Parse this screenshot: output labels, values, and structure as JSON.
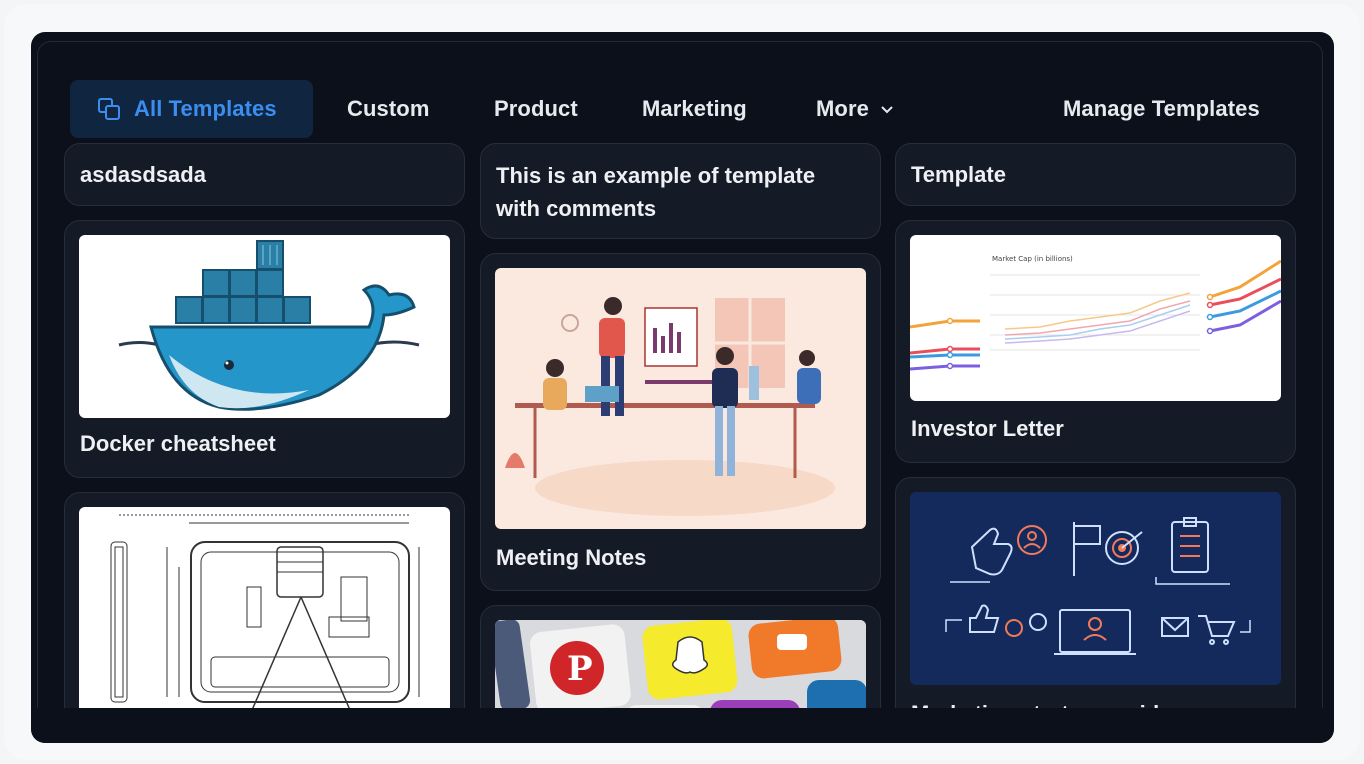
{
  "tabs": {
    "all": "All Templates",
    "custom": "Custom",
    "product": "Product",
    "marketing": "Marketing",
    "more": "More",
    "manage": "Manage Templates"
  },
  "cards": {
    "c1": "asdasdsada",
    "c2": "This is an example of template with comments",
    "c3": "Template",
    "docker": "Docker cheatsheet",
    "meeting": "Meeting Notes",
    "investor": "Investor Letter",
    "marketing_strategy": "Marketing strategy guide"
  },
  "colors": {
    "accent": "#3b8ef0",
    "background": "#0b101a",
    "card": "#141b26"
  }
}
